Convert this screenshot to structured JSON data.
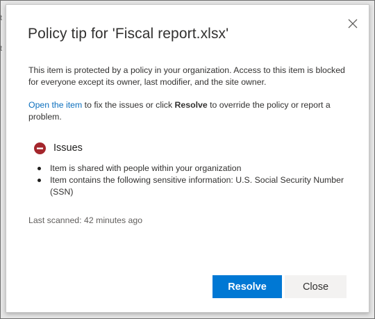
{
  "background": {
    "glyph_1": "t",
    "glyph_2": "t"
  },
  "dialog": {
    "title": "Policy tip for 'Fiscal report.xlsx'",
    "close_icon": "close-icon",
    "description": "This item is protected by a policy in your organization. Access to this item is blocked for everyone except its owner, last modifier, and the site owner.",
    "action_link": "Open the item",
    "action_text_1": " to fix the issues or click ",
    "action_bold": "Resolve",
    "action_text_2": " to override the policy or report a problem.",
    "issues": {
      "icon": "stop-icon",
      "icon_color": "#a4262c",
      "heading": "Issues",
      "items": [
        "Item is shared with people within your organization",
        "Item contains the following sensitive information: U.S. Social Security Number (SSN)"
      ]
    },
    "last_scanned": "Last scanned: 42 minutes ago",
    "buttons": {
      "primary": "Resolve",
      "secondary": "Close"
    }
  },
  "colors": {
    "accent": "#0078d4",
    "link": "#0a6ebd",
    "text": "#323130"
  }
}
